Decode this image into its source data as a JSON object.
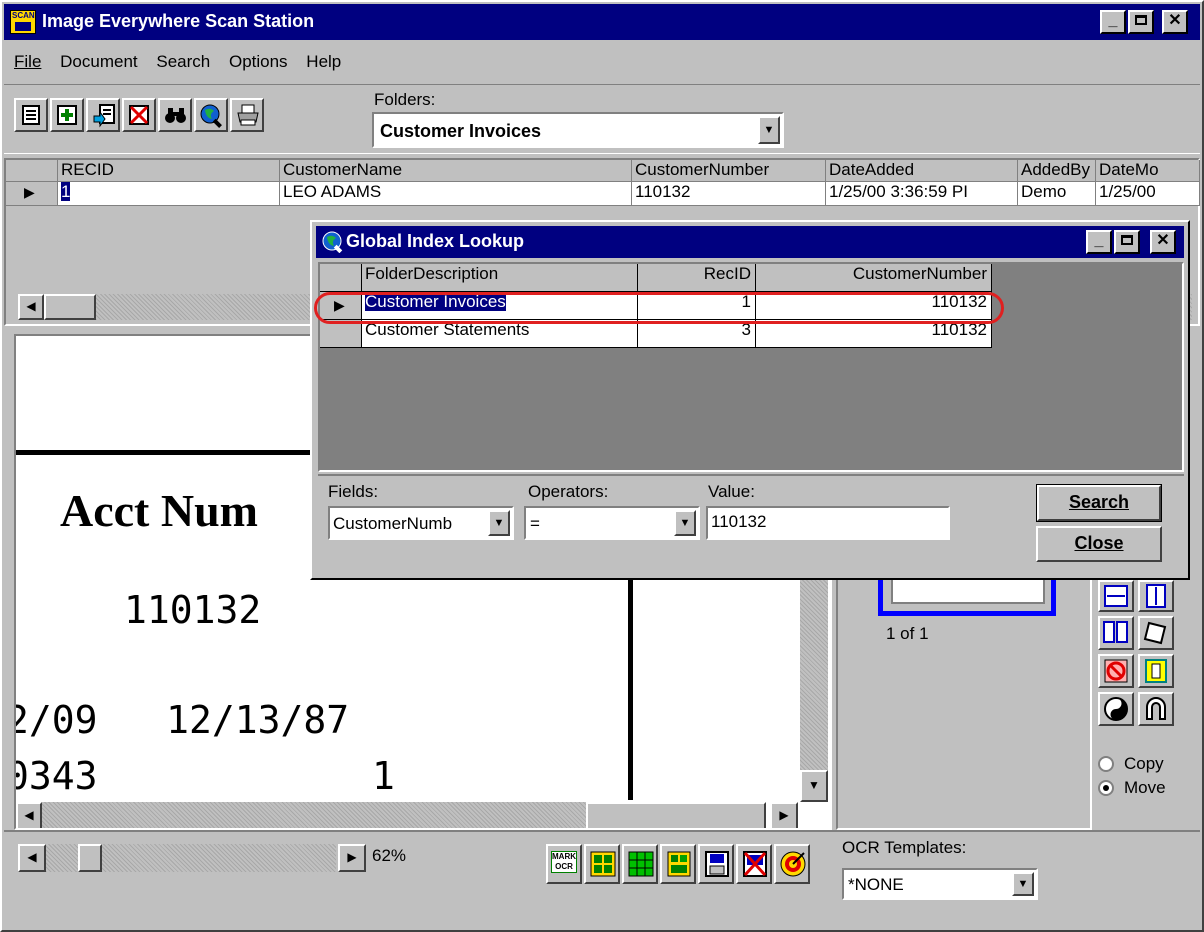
{
  "window": {
    "title": "Image Everywhere Scan Station",
    "app_icon_text": "SCAN"
  },
  "menu": [
    {
      "label": "File"
    },
    {
      "label": "Document"
    },
    {
      "label": "Search"
    },
    {
      "label": "Options"
    },
    {
      "label": "Help"
    }
  ],
  "toolbar": {
    "folders_label": "Folders:",
    "folder_value": "Customer Invoices",
    "icons": [
      "new-document-icon",
      "add-icon",
      "scan-batch-icon",
      "delete-icon",
      "binoculars-icon",
      "globe-search-icon",
      "printer-icon"
    ]
  },
  "grid": {
    "columns": [
      "RECID",
      "CustomerName",
      "CustomerNumber",
      "DateAdded",
      "AddedBy",
      "DateMo"
    ],
    "rows": [
      {
        "RECID": "1",
        "CustomerName": "LEO ADAMS",
        "CustomerNumber": "110132",
        "DateAdded": "1/25/00 3:36:59 PI",
        "AddedBy": "Demo",
        "DateMo": "1/25/00"
      }
    ]
  },
  "document": {
    "heading": "Acct Num",
    "acct": "110132",
    "line1": "2/09   12/13/87",
    "line2": "0343            1"
  },
  "thumb": {
    "page_indicator": "1 of 1"
  },
  "options": {
    "copy_label": "Copy",
    "move_label": "Move",
    "selected": "Move"
  },
  "statusbar": {
    "zoom": "62%",
    "ocr_templates_label": "OCR Templates:",
    "ocr_template_value": "*NONE",
    "ocr_icons": [
      "mark-ocr-icon",
      "ocr-zone-icon",
      "ocr-zone-green-icon",
      "ocr-page-icon",
      "ocr-disk-icon",
      "ocr-cancel-icon",
      "target-icon"
    ],
    "mark_ocr_text": "MARK OCR"
  },
  "dialog": {
    "title": "Global Index Lookup",
    "columns": [
      "FolderDescription",
      "RecID",
      "CustomerNumber"
    ],
    "rows": [
      {
        "FolderDescription": "Customer Invoices",
        "RecID": "1",
        "CustomerNumber": "110132"
      },
      {
        "FolderDescription": "Customer Statements",
        "RecID": "3",
        "CustomerNumber": "110132"
      }
    ],
    "fields_label": "Fields:",
    "field_value": "CustomerNumb",
    "operators_label": "Operators:",
    "operator_value": "=",
    "value_label": "Value:",
    "value": "110132",
    "search_button": "Search",
    "close_button": "Close"
  },
  "colors": {
    "titlebar": "#000080",
    "highlight_ring": "#e02020",
    "selection": "#000080",
    "thumb_border": "#0000ff"
  }
}
